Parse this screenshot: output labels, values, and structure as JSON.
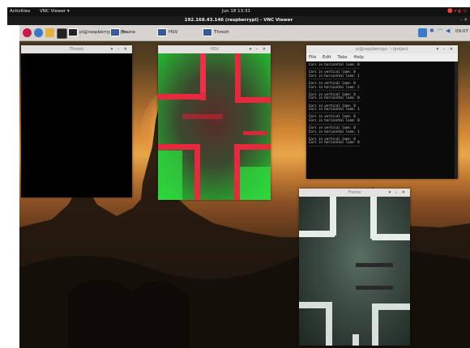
{
  "gnome": {
    "activities": "Activities",
    "app": "VNC Viewer ▾",
    "clock": "Jun 18  13:31",
    "status_icons": "🔴 ▾ ◐ ⏻"
  },
  "vnc": {
    "window_title": "192.168.43.146 (raspberrypi) - VNC Viewer",
    "controls": "– ✕"
  },
  "panel": {
    "tasks": [
      "pi@raspberrypi: ~/pr...",
      "Frame",
      "HSV",
      "Thresh"
    ],
    "clock": "09:07",
    "tray_icons": [
      "bluetooth-icon",
      "wifi-icon",
      "volume-icon"
    ]
  },
  "windows": {
    "thresh": {
      "title": "Thresh",
      "controls": "▾ – ✕"
    },
    "hsv": {
      "title": "HSV",
      "controls": "▾ – ✕"
    },
    "terminal": {
      "title": "pi@raspberrypi: ~/project",
      "controls": "▾ – ✕",
      "menu": [
        "File",
        "Edit",
        "Tabs",
        "Help"
      ],
      "lines": [
        "Cars in horizontal lane:  0",
        "--------------------------",
        "Cars in vertical lane:  0",
        "Cars in horizontal lane:  1",
        "--------------------------",
        "Cars in vertical lane:  0",
        "Cars in horizontal lane:  2",
        "--------------------------",
        "Cars in vertical lane:  0",
        "Cars in horizontal lane:  0",
        "--------------------------",
        "Cars in vertical lane:  0",
        "Cars in horizontal lane:  1",
        "--------------------------",
        "Cars in vertical lane:  0",
        "Cars in horizontal lane:  0",
        "--------------------------",
        "Cars in vertical lane:  0",
        "Cars in horizontal lane:  1",
        "--------------------------",
        "Cars in vertical lane:  0",
        "Cars in horizontal lane:  0",
        "--------------------------"
      ]
    },
    "frame": {
      "title": "Frame",
      "controls": "▾ – ✕"
    }
  }
}
